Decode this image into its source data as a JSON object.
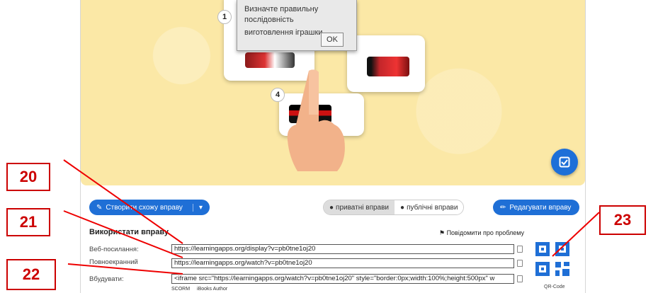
{
  "dialog": {
    "text_line1": "Визначте правильну послідовність",
    "text_line2": "виготовлення іграшки",
    "ok": "OK"
  },
  "cards": [
    {
      "number": "1"
    },
    {
      "number": "4"
    }
  ],
  "toolbar": {
    "create_similar": "Створити схожу вправу",
    "private": "приватні вправи",
    "public": "публічні вправи",
    "edit": "Редагувати вправу"
  },
  "use": {
    "heading": "Використати вправу",
    "report": "Повідомити про проблему",
    "rows": [
      {
        "label": "Веб-посилання:",
        "value": "https://learningapps.org/display?v=pb0tne1oj20"
      },
      {
        "label": "Повноекранний",
        "value": "https://learningapps.org/watch?v=pb0tne1oj20"
      },
      {
        "label": "Вбудувати:",
        "value": "<iframe src=\"https://learningapps.org/watch?v=pb0tne1oj20\" style=\"border:0px;width:100%;height:500px\" w"
      }
    ],
    "bottom_links": [
      "SCORM",
      "iBooks Author"
    ],
    "qr_label": "QR-Code"
  },
  "callouts": [
    "20",
    "21",
    "22",
    "23"
  ],
  "colors": {
    "accent_blue": "#1f6fd6",
    "callout_red": "#cc0000",
    "stage_yellow": "#fbe8a6"
  }
}
